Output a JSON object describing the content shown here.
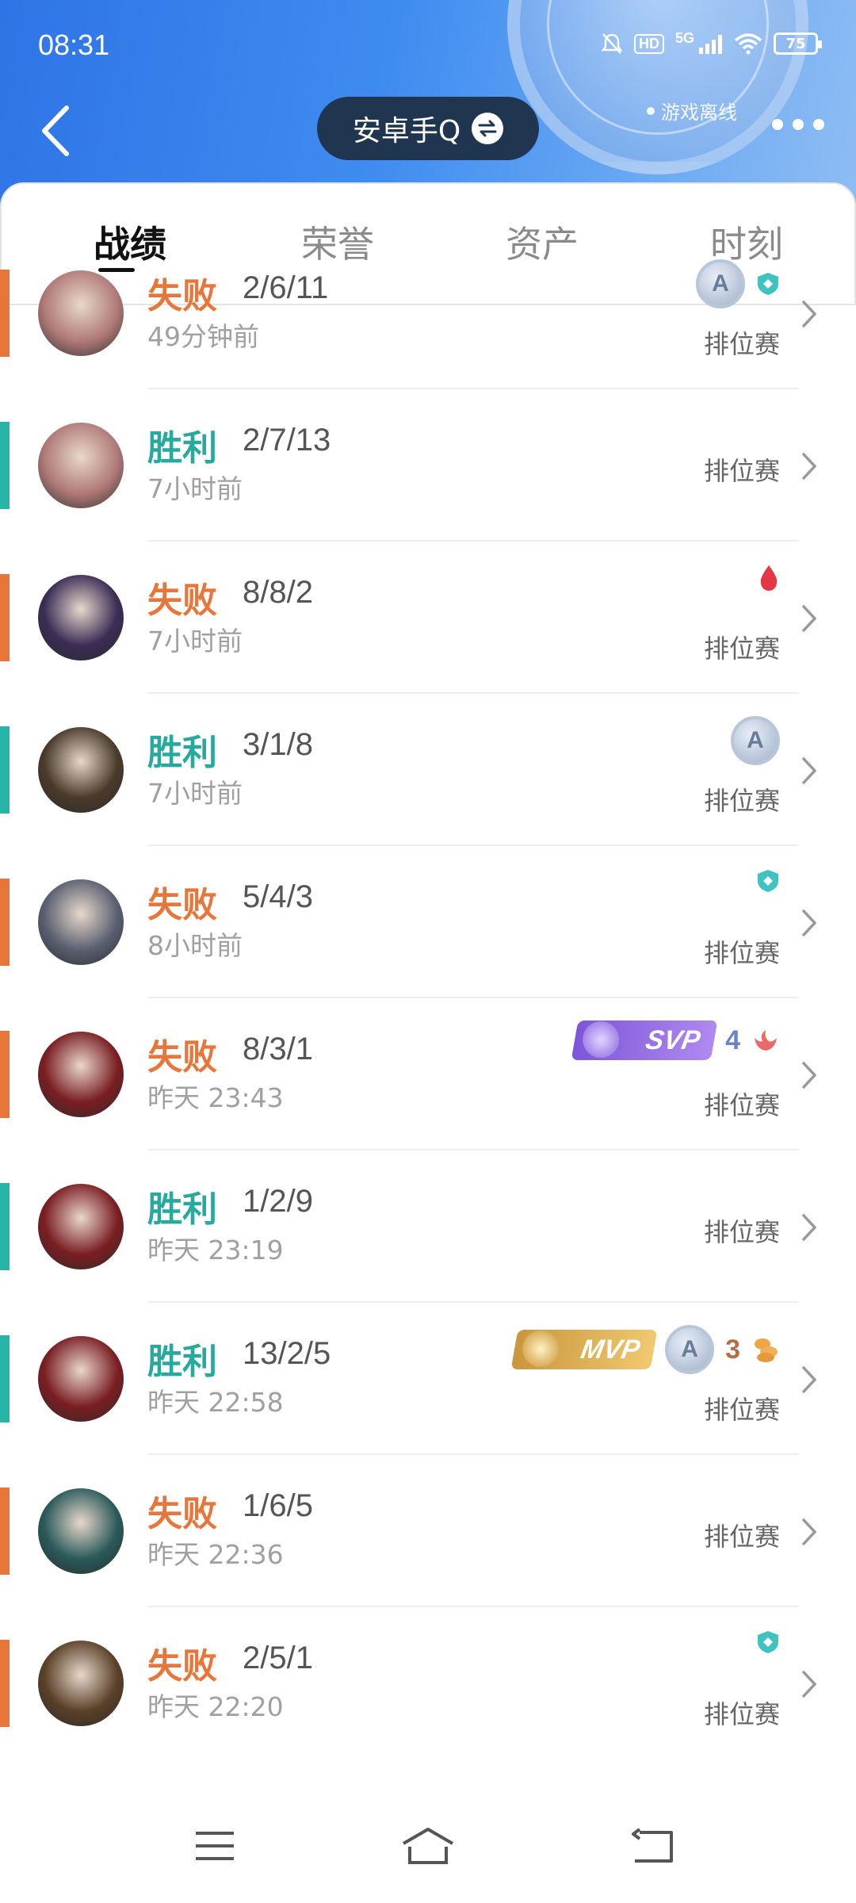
{
  "status_bar": {
    "time": "08:31",
    "hd": "HD",
    "network": "5G",
    "battery": "75"
  },
  "header": {
    "offline_status": "游戏离线",
    "account_name": "安卓手Q"
  },
  "tabs": [
    {
      "label": "战绩",
      "active": true
    },
    {
      "label": "荣誉",
      "active": false
    },
    {
      "label": "资产",
      "active": false
    },
    {
      "label": "时刻",
      "active": false
    }
  ],
  "matches": [
    {
      "result": "失败",
      "outcome": "loss",
      "kda": "2/6/11",
      "time": "49分钟前",
      "mode": "排位赛",
      "hero_color": "#b07a78",
      "badges": [
        "a-rank",
        "shield"
      ]
    },
    {
      "result": "胜利",
      "outcome": "win",
      "kda": "2/7/13",
      "time": "7小时前",
      "mode": "排位赛",
      "hero_color": "#b07a78",
      "badges": []
    },
    {
      "result": "失败",
      "outcome": "loss",
      "kda": "8/8/2",
      "time": "7小时前",
      "mode": "排位赛",
      "hero_color": "#3a2d55",
      "badges": [
        "blood-drop"
      ]
    },
    {
      "result": "胜利",
      "outcome": "win",
      "kda": "3/1/8",
      "time": "7小时前",
      "mode": "排位赛",
      "hero_color": "#4a3a2a",
      "badges": [
        "a-rank"
      ]
    },
    {
      "result": "失败",
      "outcome": "loss",
      "kda": "5/4/3",
      "time": "8小时前",
      "mode": "排位赛",
      "hero_color": "#5a6070",
      "badges": [
        "shield"
      ]
    },
    {
      "result": "失败",
      "outcome": "loss",
      "kda": "8/3/1",
      "time": "昨天  23:43",
      "mode": "排位赛",
      "hero_color": "#7a1e22",
      "badges": [
        "svp",
        "num-4",
        "flame"
      ],
      "svp_label": "SVP",
      "num_label": "4"
    },
    {
      "result": "胜利",
      "outcome": "win",
      "kda": "1/2/9",
      "time": "昨天  23:19",
      "mode": "排位赛",
      "hero_color": "#7a1e22",
      "badges": []
    },
    {
      "result": "胜利",
      "outcome": "win",
      "kda": "13/2/5",
      "time": "昨天  22:58",
      "mode": "排位赛",
      "hero_color": "#7a1e22",
      "badges": [
        "mvp",
        "a-rank",
        "num-3",
        "coins"
      ],
      "mvp_label": "MVP",
      "num_label": "3"
    },
    {
      "result": "失败",
      "outcome": "loss",
      "kda": "1/6/5",
      "time": "昨天  22:36",
      "mode": "排位赛",
      "hero_color": "#2a5a5a",
      "badges": []
    },
    {
      "result": "失败",
      "outcome": "loss",
      "kda": "2/5/1",
      "time": "昨天  22:20",
      "mode": "排位赛",
      "hero_color": "#5a4028",
      "badges": [
        "shield"
      ]
    }
  ],
  "colors": {
    "loss": "#e8763a",
    "win": "#28a99e",
    "header_blue": "#3f8cf0"
  },
  "icons": {
    "back": "chevron-left-icon",
    "swap": "swap-icon",
    "more": "more-dots-icon",
    "row_arrow": "chevron-right-icon",
    "nav_menu": "menu-icon",
    "nav_home": "home-icon",
    "nav_back": "back-icon"
  }
}
